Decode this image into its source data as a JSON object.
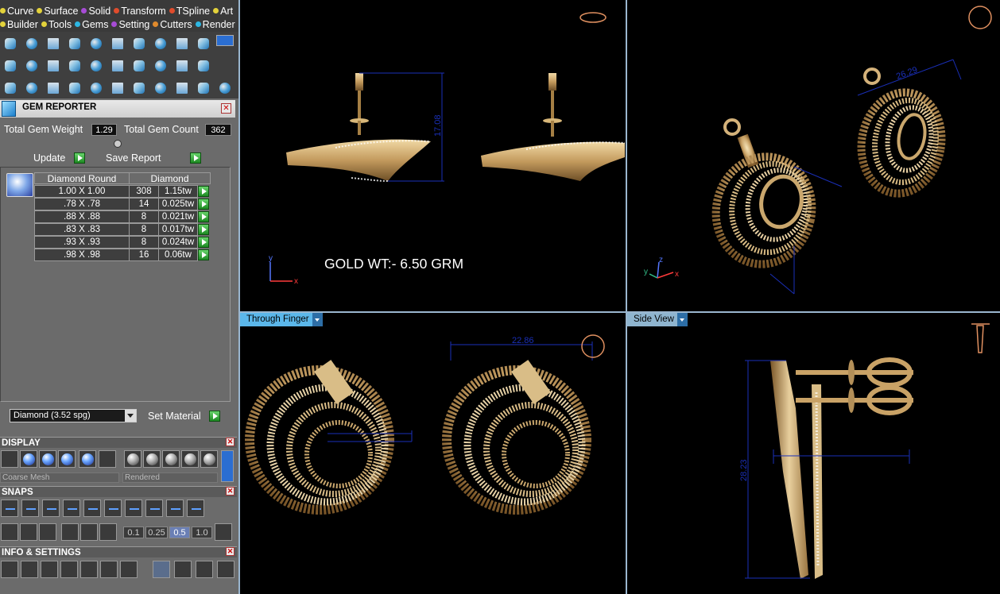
{
  "menu": {
    "row1": [
      {
        "label": "Curve",
        "color": "#e3d23b"
      },
      {
        "label": "Surface",
        "color": "#e3d23b"
      },
      {
        "label": "Solid",
        "color": "#a74cd6"
      },
      {
        "label": "Transform",
        "color": "#e04c2c"
      },
      {
        "label": "TSpline",
        "color": "#e04c2c"
      },
      {
        "label": "Art",
        "color": "#e3d23b"
      }
    ],
    "row2": [
      {
        "label": "Builder",
        "color": "#e3d23b"
      },
      {
        "label": "Tools",
        "color": "#e3d23b"
      },
      {
        "label": "Gems",
        "color": "#2db7e3"
      },
      {
        "label": "Setting",
        "color": "#a74cd6"
      },
      {
        "label": "Cutters",
        "color": "#e08a2c"
      },
      {
        "label": "Render",
        "color": "#2db7e3"
      }
    ]
  },
  "gem_reporter": {
    "title": "GEM REPORTER",
    "total_gem_weight_label": "Total Gem Weight",
    "total_gem_weight": "1.29",
    "total_gem_count_label": "Total Gem Count",
    "total_gem_count": "362",
    "update_label": "Update",
    "save_report_label": "Save Report",
    "table_headers": [
      "Diamond Round",
      "Diamond"
    ],
    "rows": [
      {
        "size": "1.00 X 1.00",
        "count": "308",
        "weight": "1.15tw"
      },
      {
        "size": ".78 X .78",
        "count": "14",
        "weight": "0.025tw"
      },
      {
        "size": ".88 X .88",
        "count": "8",
        "weight": "0.021tw"
      },
      {
        "size": ".83 X .83",
        "count": "8",
        "weight": "0.017tw"
      },
      {
        "size": ".93 X .93",
        "count": "8",
        "weight": "0.024tw"
      },
      {
        "size": ".98 X .98",
        "count": "16",
        "weight": "0.06tw"
      }
    ],
    "material_value": "Diamond    (3.52 spg)",
    "set_material_label": "Set Material"
  },
  "display": {
    "title": "DISPLAY",
    "mesh_select": "Coarse Mesh",
    "render_select": "Rendered"
  },
  "snaps": {
    "title": "SNAPS",
    "values": [
      "0.1",
      "0.25",
      "0.5",
      "1.0"
    ],
    "active_value": "0.5"
  },
  "info": {
    "title": "INFO & SETTINGS"
  },
  "viewports": {
    "top_left": {
      "annotation": "GOLD WT:- 6.50 GRM",
      "dimension": "17.08",
      "axis_labels": [
        "y",
        "x"
      ]
    },
    "top_right": {
      "dimension": "26.29",
      "axis_labels": [
        "z",
        "y",
        "x"
      ]
    },
    "bottom_left": {
      "label": "Through Finger",
      "dimension": "22.86"
    },
    "bottom_right": {
      "label": "Side View",
      "dimension": "28.23"
    }
  },
  "colors": {
    "accent_blue": "#5bb7ea",
    "gold": "#c8a36b",
    "dimension_blue": "#1a2fb8"
  }
}
